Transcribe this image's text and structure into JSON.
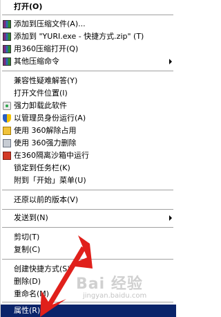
{
  "menu": {
    "items": [
      {
        "label": "打开(O)",
        "bold": true
      },
      {
        "label": "添加到压缩文件(A)...",
        "icon": "winrar-icon"
      },
      {
        "label": "添加到 \"YURI.exe - 快捷方式.zip\" (T)",
        "icon": "winrar-icon"
      },
      {
        "label": "用360压缩打开(Q)",
        "icon": "winrar-icon"
      },
      {
        "label": "其他压缩命令",
        "icon": "winrar-icon",
        "submenu": true
      },
      {
        "label": "兼容性疑难解答(Y)"
      },
      {
        "label": "打开文件位置(I)"
      },
      {
        "label": "强力卸载此软件",
        "icon": "uninstall-icon"
      },
      {
        "label": "以管理员身份运行(A)",
        "icon": "shield-icon"
      },
      {
        "label": "使用 360解除占用",
        "icon": "folder-unlock-icon"
      },
      {
        "label": "使用 360强力删除",
        "icon": "shredder-icon"
      },
      {
        "label": "在360隔离沙箱中运行",
        "icon": "sandbox-icon"
      },
      {
        "label": "锁定到任务栏(K)"
      },
      {
        "label": "附到「开始」菜单(U)"
      },
      {
        "label": "还原以前的版本(V)"
      },
      {
        "label": "发送到(N)",
        "submenu": true
      },
      {
        "label": "剪切(T)"
      },
      {
        "label": "复制(C)"
      },
      {
        "label": "创建快捷方式(S)"
      },
      {
        "label": "删除(D)"
      },
      {
        "label": "重命名(M)"
      },
      {
        "label": "属性(R)",
        "selected": true
      }
    ]
  },
  "watermark": {
    "brand": "Bai 经验",
    "url": "jingyan.baidu.com"
  },
  "annotation_color": "#e0201b"
}
